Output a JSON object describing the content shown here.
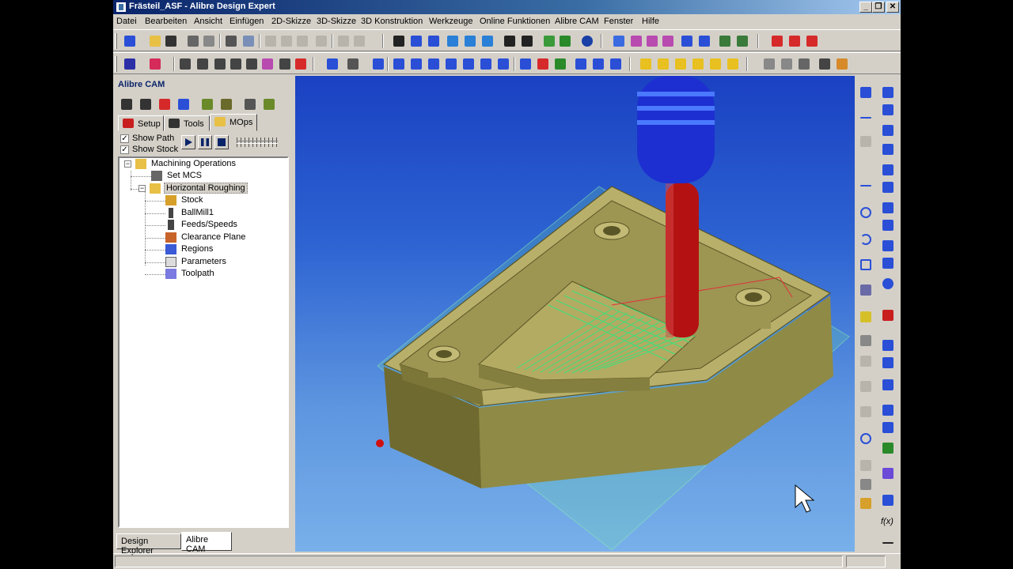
{
  "window": {
    "title": "Frästeil_ASF - Alibre Design Expert"
  },
  "menu": [
    "Datei",
    "Bearbeiten",
    "Ansicht",
    "Einfügen",
    "2D-Skizze",
    "3D-Skizze",
    "3D Konstruktion",
    "Werkzeuge",
    "Online Funktionen",
    "Alibre CAM",
    "Fenster",
    "Hilfe"
  ],
  "panel": {
    "title": "Alibre CAM",
    "tabs": [
      "Setup",
      "Tools",
      "MOps"
    ],
    "active_tab": "MOps",
    "show_path": {
      "label": "Show Path",
      "checked": true
    },
    "show_stock": {
      "label": "Show Stock",
      "checked": true
    },
    "tree": {
      "root": "Machining Operations",
      "set_mcs": "Set MCS",
      "operation": "Horizontal Roughing",
      "children": [
        "Stock",
        "BallMill1",
        "Feeds/Speeds",
        "Clearance Plane",
        "Regions",
        "Parameters",
        "Toolpath"
      ]
    },
    "bottom_tabs": [
      "Design Explorer",
      "Alibre CAM"
    ],
    "bottom_active": "Alibre CAM"
  },
  "rightbar": {
    "fx_label": "f(x)"
  },
  "colors": {
    "title_active": "#0a246a",
    "viewport_top": "#1a41c2",
    "viewport_bottom": "#78b0ea",
    "part": "#a9a25a",
    "toolpath": "#3ae07a",
    "tool_shank": "#1d2fd1",
    "tool_bit": "#b41212"
  }
}
